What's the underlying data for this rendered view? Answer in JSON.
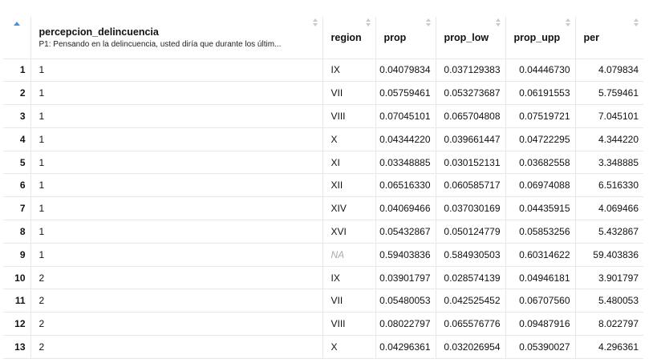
{
  "table": {
    "columns": [
      {
        "title": "percepcion_delincuencia",
        "subtitle": "P1: Pensando en la delincuencia, usted diría que durante los últim..."
      },
      {
        "title": "region"
      },
      {
        "title": "prop"
      },
      {
        "title": "prop_low"
      },
      {
        "title": "prop_upp"
      },
      {
        "title": "per"
      }
    ],
    "rows": [
      {
        "idx": "1",
        "percepcion": "1",
        "region": "IX",
        "prop": "0.04079834",
        "prop_low": "0.037129383",
        "prop_upp": "0.04446730",
        "per": "4.079834"
      },
      {
        "idx": "2",
        "percepcion": "1",
        "region": "VII",
        "prop": "0.05759461",
        "prop_low": "0.053273687",
        "prop_upp": "0.06191553",
        "per": "5.759461"
      },
      {
        "idx": "3",
        "percepcion": "1",
        "region": "VIII",
        "prop": "0.07045101",
        "prop_low": "0.065704808",
        "prop_upp": "0.07519721",
        "per": "7.045101"
      },
      {
        "idx": "4",
        "percepcion": "1",
        "region": "X",
        "prop": "0.04344220",
        "prop_low": "0.039661447",
        "prop_upp": "0.04722295",
        "per": "4.344220"
      },
      {
        "idx": "5",
        "percepcion": "1",
        "region": "XI",
        "prop": "0.03348885",
        "prop_low": "0.030152131",
        "prop_upp": "0.03682558",
        "per": "3.348885"
      },
      {
        "idx": "6",
        "percepcion": "1",
        "region": "XII",
        "prop": "0.06516330",
        "prop_low": "0.060585717",
        "prop_upp": "0.06974088",
        "per": "6.516330"
      },
      {
        "idx": "7",
        "percepcion": "1",
        "region": "XIV",
        "prop": "0.04069466",
        "prop_low": "0.037030169",
        "prop_upp": "0.04435915",
        "per": "4.069466"
      },
      {
        "idx": "8",
        "percepcion": "1",
        "region": "XVI",
        "prop": "0.05432867",
        "prop_low": "0.050124779",
        "prop_upp": "0.05853256",
        "per": "5.432867"
      },
      {
        "idx": "9",
        "percepcion": "1",
        "region": "NA",
        "prop": "0.59403836",
        "prop_low": "0.584930503",
        "prop_upp": "0.60314622",
        "per": "59.403836"
      },
      {
        "idx": "10",
        "percepcion": "2",
        "region": "IX",
        "prop": "0.03901797",
        "prop_low": "0.028574139",
        "prop_upp": "0.04946181",
        "per": "3.901797"
      },
      {
        "idx": "11",
        "percepcion": "2",
        "region": "VII",
        "prop": "0.05480053",
        "prop_low": "0.042525452",
        "prop_upp": "0.06707560",
        "per": "5.480053"
      },
      {
        "idx": "12",
        "percepcion": "2",
        "region": "VIII",
        "prop": "0.08022797",
        "prop_low": "0.065576776",
        "prop_upp": "0.09487916",
        "per": "8.022797"
      },
      {
        "idx": "13",
        "percepcion": "2",
        "region": "X",
        "prop": "0.04296361",
        "prop_low": "0.032026954",
        "prop_upp": "0.05390027",
        "per": "4.296361"
      }
    ]
  },
  "colors": {
    "grid_line": "#e8e8e8",
    "na_text": "#aaaaaa",
    "sort_active": "#4a90e2",
    "sort_inactive": "#c9c9c9"
  }
}
